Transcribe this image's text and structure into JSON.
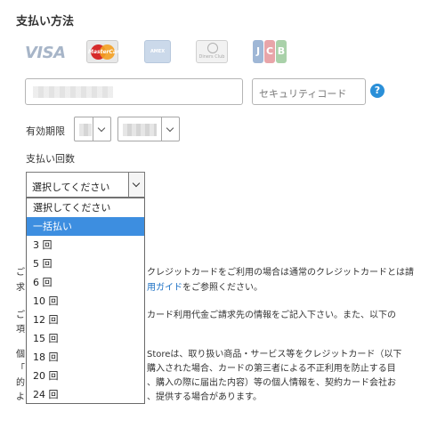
{
  "section_title": "支払い方法",
  "card_brands": {
    "visa": "VISA",
    "mastercard": "MasterCard",
    "amex": "AMEX",
    "diners": "Diners Club",
    "jcb": [
      "J",
      "C",
      "B"
    ]
  },
  "card_number": {
    "value": ""
  },
  "security_code": {
    "placeholder": "セキュリティコード"
  },
  "help_icon": "?",
  "expiry": {
    "label": "有効期限"
  },
  "installments": {
    "label": "支払い回数",
    "selected_value": "選択してください",
    "options": [
      "選択してください",
      "一括払い",
      "3 回",
      "5 回",
      "6 回",
      "10 回",
      "12 回",
      "15 回",
      "18 回",
      "20 回",
      "24 回"
    ],
    "highlighted_index": 1
  },
  "notes": {
    "p1_line1": "クレジットカードをご利用の場合は通常のクレジットカードとは請",
    "p1_line2_link": "用ガイド",
    "p1_line2_rest": "をご参照ください。",
    "p2_line1": "カード利用代金ご請求先の情報をご記入下さい。また、以下の",
    "p3_line1": "Storeは、取り扱い商品・サービス等をクレジットカード（以下",
    "p3_line2": "購入された場合、カードの第三者による不正利用を防止する目",
    "p3_line3": "、購入の際に届出た内容）等の個人情報を、契約カード会社お",
    "p3_line4": "、提供する場合があります。",
    "left_chars": [
      "ご",
      "求",
      "ご",
      "項",
      "個",
      "「カ",
      "的",
      "よ"
    ]
  }
}
